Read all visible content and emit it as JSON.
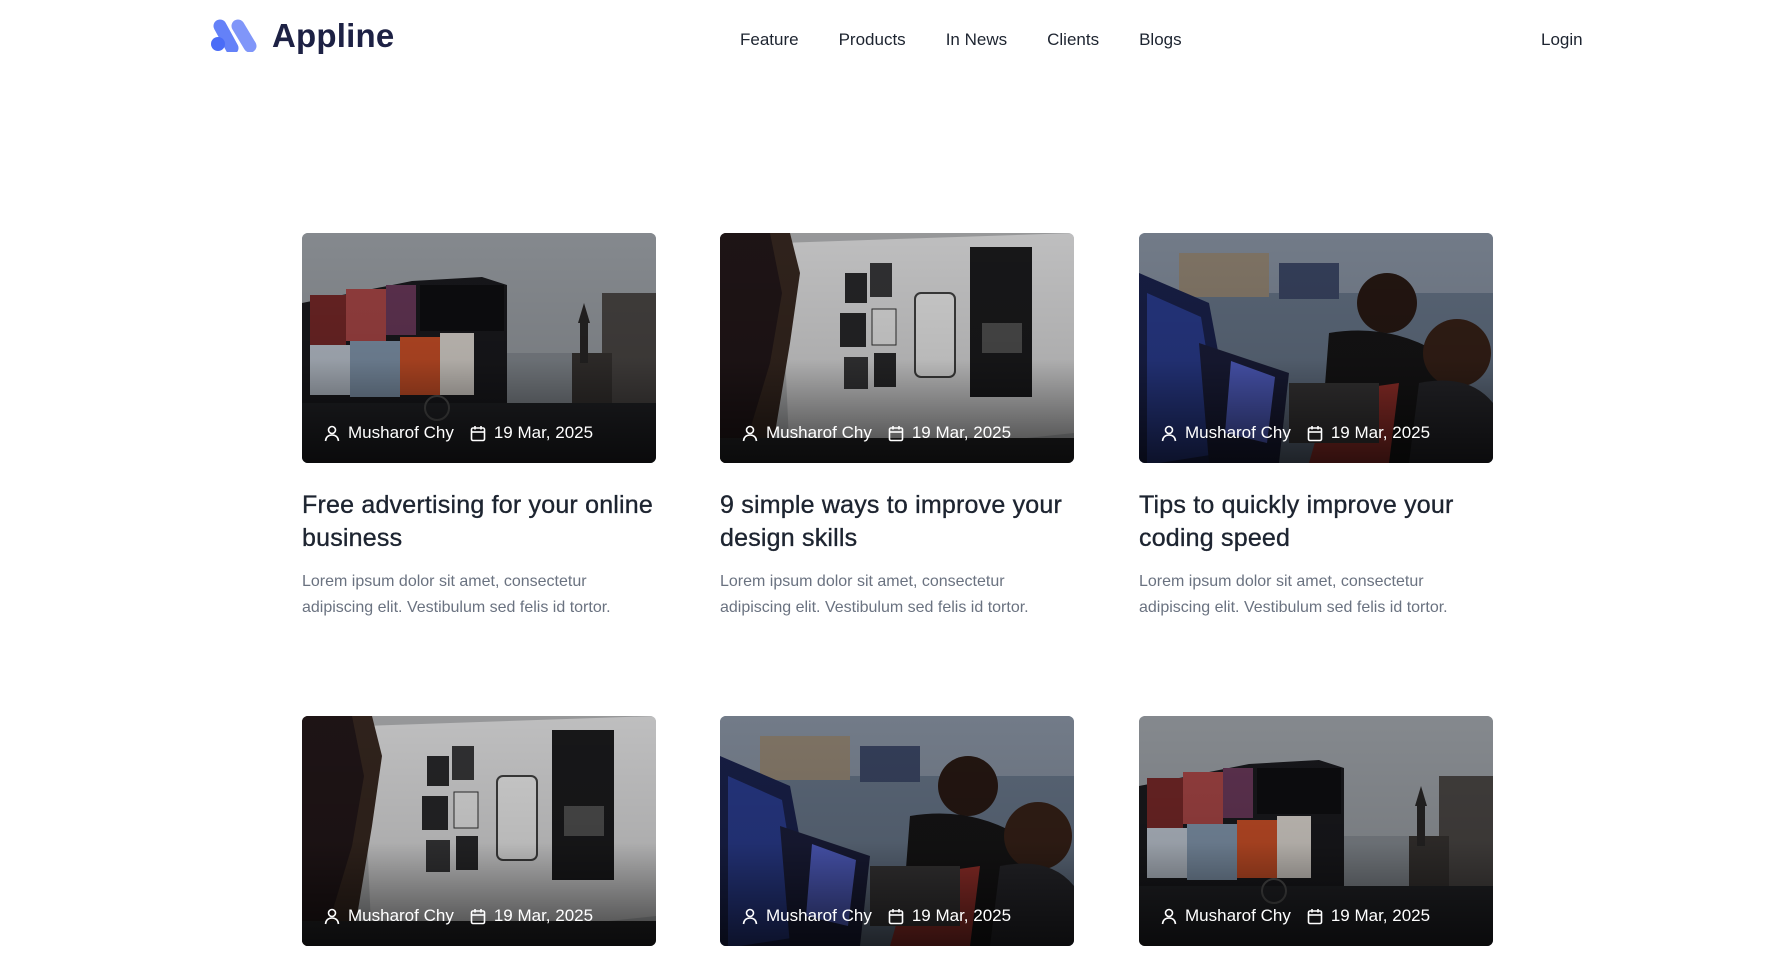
{
  "brand": {
    "name": "Appline",
    "accent": "#4a6cf7"
  },
  "nav": {
    "items": [
      "Feature",
      "Products",
      "In News",
      "Clients",
      "Blogs"
    ],
    "login": "Login"
  },
  "posts": [
    {
      "author": "Musharof Chy",
      "date": "19 Mar, 2025",
      "title": "Free advertising for your online business",
      "excerpt": "Lorem ipsum dolor sit amet, consectetur adipiscing elit. Vestibulum sed felis id tortor.",
      "image": "city-billboard-photo"
    },
    {
      "author": "Musharof Chy",
      "date": "19 Mar, 2025",
      "title": "9 simple ways to improve your design skills",
      "excerpt": "Lorem ipsum dolor sit amet, consectetur adipiscing elit. Vestibulum sed felis id tortor.",
      "image": "designer-monitor-photo"
    },
    {
      "author": "Musharof Chy",
      "date": "19 Mar, 2025",
      "title": "Tips to quickly improve your coding speed",
      "excerpt": "Lorem ipsum dolor sit amet, consectetur adipiscing elit. Vestibulum sed felis id tortor.",
      "image": "coders-laptop-photo"
    },
    {
      "author": "Musharof Chy",
      "date": "19 Mar, 2025",
      "image": "designer-monitor-photo"
    },
    {
      "author": "Musharof Chy",
      "date": "19 Mar, 2025",
      "image": "coders-laptop-photo"
    },
    {
      "author": "Musharof Chy",
      "date": "19 Mar, 2025",
      "image": "city-billboard-photo"
    }
  ]
}
